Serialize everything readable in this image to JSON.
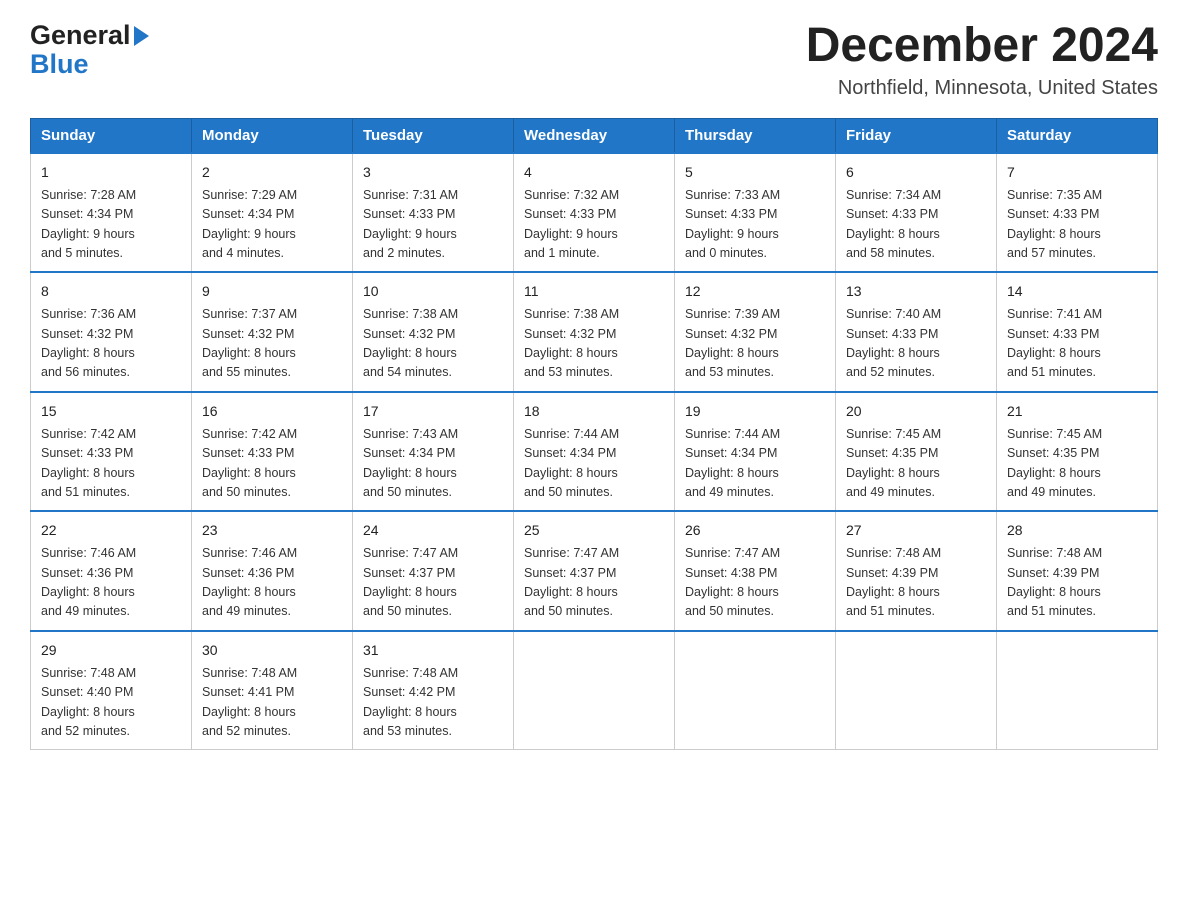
{
  "header": {
    "logo_general": "General",
    "logo_blue": "Blue",
    "main_title": "December 2024",
    "subtitle": "Northfield, Minnesota, United States"
  },
  "days_of_week": [
    "Sunday",
    "Monday",
    "Tuesday",
    "Wednesday",
    "Thursday",
    "Friday",
    "Saturday"
  ],
  "weeks": [
    [
      {
        "num": "1",
        "sunrise": "7:28 AM",
        "sunset": "4:34 PM",
        "daylight": "9 hours and 5 minutes."
      },
      {
        "num": "2",
        "sunrise": "7:29 AM",
        "sunset": "4:34 PM",
        "daylight": "9 hours and 4 minutes."
      },
      {
        "num": "3",
        "sunrise": "7:31 AM",
        "sunset": "4:33 PM",
        "daylight": "9 hours and 2 minutes."
      },
      {
        "num": "4",
        "sunrise": "7:32 AM",
        "sunset": "4:33 PM",
        "daylight": "9 hours and 1 minute."
      },
      {
        "num": "5",
        "sunrise": "7:33 AM",
        "sunset": "4:33 PM",
        "daylight": "9 hours and 0 minutes."
      },
      {
        "num": "6",
        "sunrise": "7:34 AM",
        "sunset": "4:33 PM",
        "daylight": "8 hours and 58 minutes."
      },
      {
        "num": "7",
        "sunrise": "7:35 AM",
        "sunset": "4:33 PM",
        "daylight": "8 hours and 57 minutes."
      }
    ],
    [
      {
        "num": "8",
        "sunrise": "7:36 AM",
        "sunset": "4:32 PM",
        "daylight": "8 hours and 56 minutes."
      },
      {
        "num": "9",
        "sunrise": "7:37 AM",
        "sunset": "4:32 PM",
        "daylight": "8 hours and 55 minutes."
      },
      {
        "num": "10",
        "sunrise": "7:38 AM",
        "sunset": "4:32 PM",
        "daylight": "8 hours and 54 minutes."
      },
      {
        "num": "11",
        "sunrise": "7:38 AM",
        "sunset": "4:32 PM",
        "daylight": "8 hours and 53 minutes."
      },
      {
        "num": "12",
        "sunrise": "7:39 AM",
        "sunset": "4:32 PM",
        "daylight": "8 hours and 53 minutes."
      },
      {
        "num": "13",
        "sunrise": "7:40 AM",
        "sunset": "4:33 PM",
        "daylight": "8 hours and 52 minutes."
      },
      {
        "num": "14",
        "sunrise": "7:41 AM",
        "sunset": "4:33 PM",
        "daylight": "8 hours and 51 minutes."
      }
    ],
    [
      {
        "num": "15",
        "sunrise": "7:42 AM",
        "sunset": "4:33 PM",
        "daylight": "8 hours and 51 minutes."
      },
      {
        "num": "16",
        "sunrise": "7:42 AM",
        "sunset": "4:33 PM",
        "daylight": "8 hours and 50 minutes."
      },
      {
        "num": "17",
        "sunrise": "7:43 AM",
        "sunset": "4:34 PM",
        "daylight": "8 hours and 50 minutes."
      },
      {
        "num": "18",
        "sunrise": "7:44 AM",
        "sunset": "4:34 PM",
        "daylight": "8 hours and 50 minutes."
      },
      {
        "num": "19",
        "sunrise": "7:44 AM",
        "sunset": "4:34 PM",
        "daylight": "8 hours and 49 minutes."
      },
      {
        "num": "20",
        "sunrise": "7:45 AM",
        "sunset": "4:35 PM",
        "daylight": "8 hours and 49 minutes."
      },
      {
        "num": "21",
        "sunrise": "7:45 AM",
        "sunset": "4:35 PM",
        "daylight": "8 hours and 49 minutes."
      }
    ],
    [
      {
        "num": "22",
        "sunrise": "7:46 AM",
        "sunset": "4:36 PM",
        "daylight": "8 hours and 49 minutes."
      },
      {
        "num": "23",
        "sunrise": "7:46 AM",
        "sunset": "4:36 PM",
        "daylight": "8 hours and 49 minutes."
      },
      {
        "num": "24",
        "sunrise": "7:47 AM",
        "sunset": "4:37 PM",
        "daylight": "8 hours and 50 minutes."
      },
      {
        "num": "25",
        "sunrise": "7:47 AM",
        "sunset": "4:37 PM",
        "daylight": "8 hours and 50 minutes."
      },
      {
        "num": "26",
        "sunrise": "7:47 AM",
        "sunset": "4:38 PM",
        "daylight": "8 hours and 50 minutes."
      },
      {
        "num": "27",
        "sunrise": "7:48 AM",
        "sunset": "4:39 PM",
        "daylight": "8 hours and 51 minutes."
      },
      {
        "num": "28",
        "sunrise": "7:48 AM",
        "sunset": "4:39 PM",
        "daylight": "8 hours and 51 minutes."
      }
    ],
    [
      {
        "num": "29",
        "sunrise": "7:48 AM",
        "sunset": "4:40 PM",
        "daylight": "8 hours and 52 minutes."
      },
      {
        "num": "30",
        "sunrise": "7:48 AM",
        "sunset": "4:41 PM",
        "daylight": "8 hours and 52 minutes."
      },
      {
        "num": "31",
        "sunrise": "7:48 AM",
        "sunset": "4:42 PM",
        "daylight": "8 hours and 53 minutes."
      },
      null,
      null,
      null,
      null
    ]
  ],
  "labels": {
    "sunrise": "Sunrise:",
    "sunset": "Sunset:",
    "daylight": "Daylight:"
  }
}
